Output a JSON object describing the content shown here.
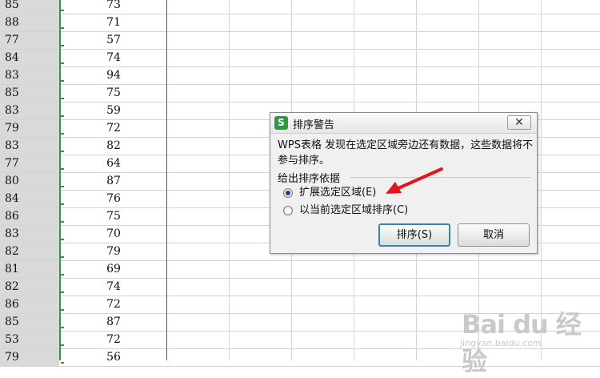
{
  "spreadsheet": {
    "rows": [
      {
        "a": "85",
        "b": "73"
      },
      {
        "a": "88",
        "b": "71"
      },
      {
        "a": "77",
        "b": "57"
      },
      {
        "a": "84",
        "b": "74"
      },
      {
        "a": "83",
        "b": "94"
      },
      {
        "a": "85",
        "b": "75"
      },
      {
        "a": "83",
        "b": "59"
      },
      {
        "a": "79",
        "b": "72"
      },
      {
        "a": "83",
        "b": "82"
      },
      {
        "a": "77",
        "b": "64"
      },
      {
        "a": "80",
        "b": "87"
      },
      {
        "a": "84",
        "b": "76"
      },
      {
        "a": "86",
        "b": "75"
      },
      {
        "a": "83",
        "b": "70"
      },
      {
        "a": "82",
        "b": "79"
      },
      {
        "a": "81",
        "b": "69"
      },
      {
        "a": "82",
        "b": "74"
      },
      {
        "a": "86",
        "b": "72"
      },
      {
        "a": "85",
        "b": "87"
      },
      {
        "a": "53",
        "b": "72"
      },
      {
        "a": "79",
        "b": "56"
      }
    ]
  },
  "dialog": {
    "title": "排序警告",
    "app_icon": "S",
    "close_label": "✕",
    "message": "WPS表格 发现在选定区域旁边还有数据，这些数据将不参与排序。",
    "group_label": "给出排序依据",
    "options": [
      {
        "label": "扩展选定区域(E)",
        "checked": true
      },
      {
        "label": "以当前选定区域排序(C)",
        "checked": false
      }
    ],
    "sort_button": "排序(S)",
    "cancel_button": "取消"
  },
  "annotation": {
    "arrow_color": "#e8141b"
  },
  "watermark": {
    "main": "Bai du 经验",
    "sub": "jingyan.baidu.com"
  }
}
